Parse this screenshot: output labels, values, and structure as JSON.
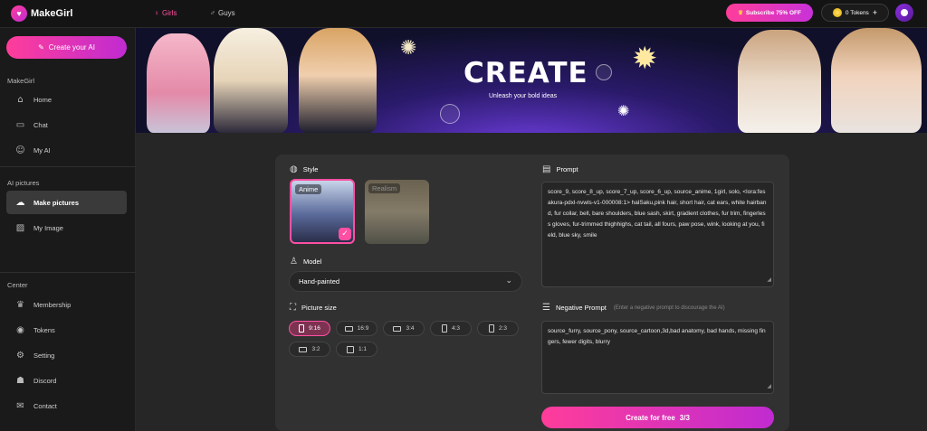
{
  "app": {
    "name": "MakeGirl",
    "logo_text": "MakeGirl"
  },
  "nav": {
    "tabs": [
      {
        "label": "Girls",
        "icon": "female-icon",
        "active": true
      },
      {
        "label": "Guys",
        "icon": "male-icon",
        "active": false
      }
    ],
    "subscribe_label": "Subscribe 75% OFF",
    "tokens_label": "0 Tokens",
    "tokens_add": "+"
  },
  "sidebar": {
    "create_button": "Create your AI",
    "groups": [
      {
        "title": "MakeGirl",
        "items": [
          {
            "label": "Home",
            "icon": "home-icon"
          },
          {
            "label": "Chat",
            "icon": "chat-icon"
          },
          {
            "label": "My AI",
            "icon": "user-icon"
          }
        ]
      },
      {
        "title": "AI pictures",
        "items": [
          {
            "label": "Make pictures",
            "icon": "magic-image-icon",
            "active": true
          },
          {
            "label": "My Image",
            "icon": "image-icon"
          }
        ]
      },
      {
        "title": "Center",
        "items": [
          {
            "label": "Membership",
            "icon": "crown-icon"
          },
          {
            "label": "Tokens",
            "icon": "coin-icon"
          },
          {
            "label": "Setting",
            "icon": "gear-icon"
          },
          {
            "label": "Discord",
            "icon": "discord-icon"
          },
          {
            "label": "Contact",
            "icon": "mail-icon"
          }
        ]
      }
    ]
  },
  "banner": {
    "title": "CREATE",
    "subtitle": "Unleash your bold ideas"
  },
  "form": {
    "style_label": "Style",
    "styles": [
      {
        "label": "Anime",
        "selected": true
      },
      {
        "label": "Realism",
        "selected": false
      }
    ],
    "model_label": "Model",
    "model_value": "Hand-painted",
    "size_label": "Picture size",
    "sizes": [
      {
        "label": "9:16",
        "active": true
      },
      {
        "label": "16:9",
        "active": false
      },
      {
        "label": "3:4",
        "active": false
      },
      {
        "label": "4:3",
        "active": false
      },
      {
        "label": "2:3",
        "active": false
      },
      {
        "label": "3:2",
        "active": false
      },
      {
        "label": "1:1",
        "active": false
      }
    ],
    "prompt_label": "Prompt",
    "prompt_value": "score_9, score_8_up, score_7_up, score_6_up, source_anime, 1girl, solo, <lora:fesakura-pdxl-nvwls-v1-000008:1> halSaku,pink hair, short hair, cat ears, white hairband, fur collar, bell, bare shoulders, blue sash, skirt, gradient clothes, fur trim, fingerless gloves, fur-trimmed thighhighs, cat tail, all fours, paw pose, wink, looking at you, field, blue sky, smile",
    "negative_label": "Negative Prompt",
    "negative_hint": "(Enter a negative prompt to discourage the AI)",
    "negative_value": "source_furry, source_pony, source_cartoon,3d,bad anatomy, bad hands, missing fingers, fewer digits, blurry",
    "create_button": "Create for free",
    "create_count": "3/3"
  }
}
